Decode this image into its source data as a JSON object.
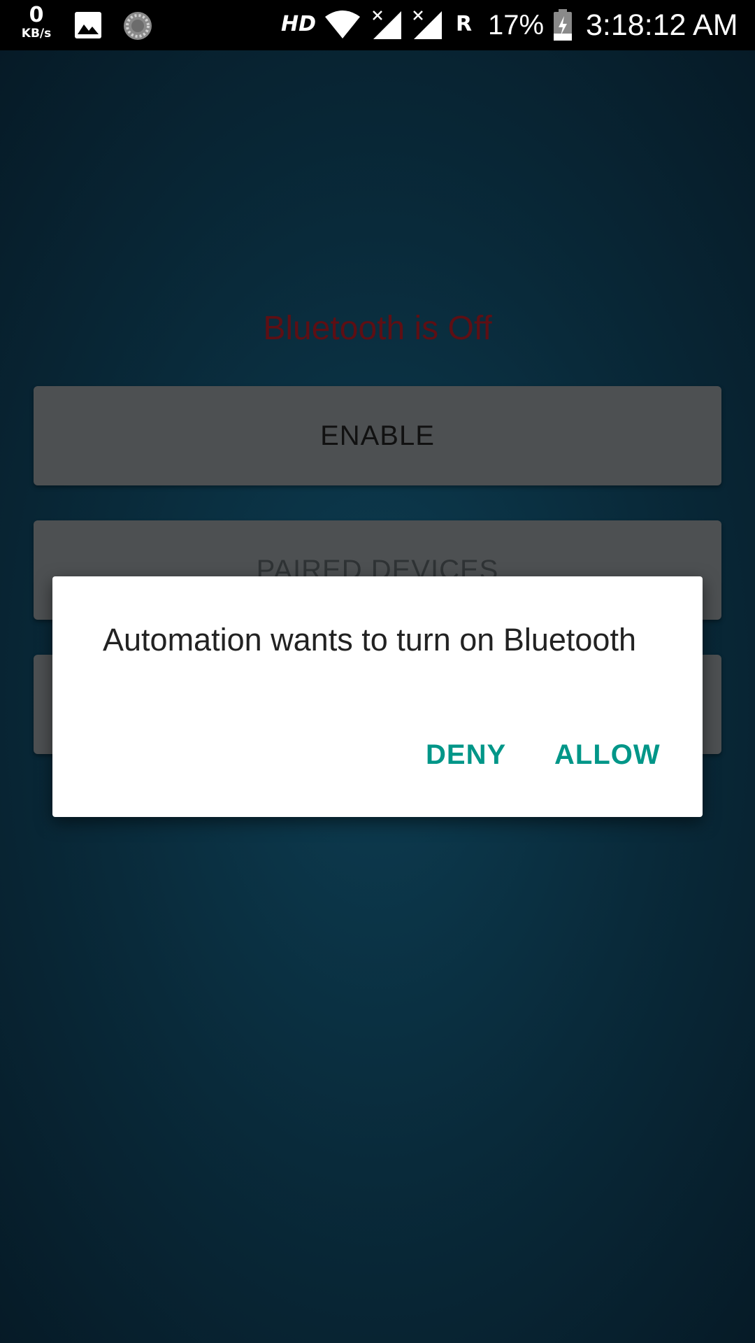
{
  "status_bar": {
    "net_speed_value": "0",
    "net_speed_unit": "KB/s",
    "hd_badge": "HD",
    "roaming_badge": "R",
    "battery_percent": "17%",
    "time": "3:18:12 AM",
    "icons": [
      "gallery-icon",
      "sync-icon",
      "wifi-icon",
      "signal-icon",
      "signal-icon",
      "battery-charging-icon"
    ]
  },
  "main": {
    "bluetooth_status": "Bluetooth is Off",
    "bluetooth_status_color": "#5e0f14",
    "enable_label": "ENABLE",
    "paired_devices_label": "PAIRED DEVICES"
  },
  "dialog": {
    "message": "Automation wants to turn on Bluetooth",
    "deny_label": "DENY",
    "allow_label": "ALLOW",
    "accent_color": "#009688"
  }
}
